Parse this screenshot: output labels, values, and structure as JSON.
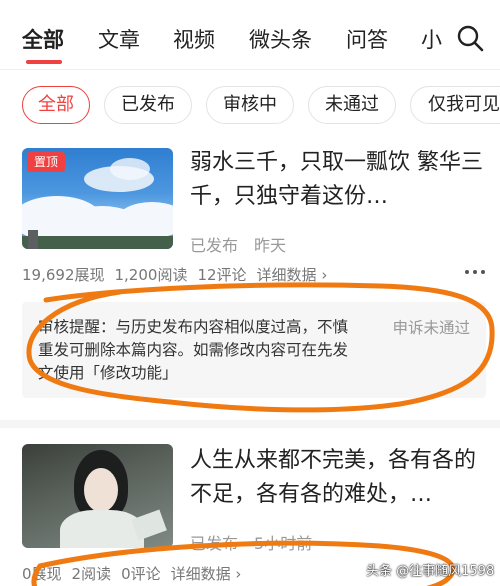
{
  "top_tabs": [
    {
      "label": "全部"
    },
    {
      "label": "文章"
    },
    {
      "label": "视频"
    },
    {
      "label": "微头条"
    },
    {
      "label": "问答"
    },
    {
      "label": "小"
    }
  ],
  "filters": [
    {
      "label": "全部"
    },
    {
      "label": "已发布"
    },
    {
      "label": "审核中"
    },
    {
      "label": "未通过"
    },
    {
      "label": "仅我可见"
    }
  ],
  "articles": [
    {
      "badge": "置顶",
      "title": "弱水三千，只取一瓢饮 繁华三千，只独守着这份…",
      "status": "已发布",
      "time": "昨天",
      "views": "19,692展现",
      "reads": "1,200阅读",
      "comments": "12评论",
      "details": "详细数据 ›",
      "review_text": "审核提醒：与历史发布内容相似度过高，不慎重发可删除本篇内容。如需修改内容可在先发文使用「修改功能」",
      "appeal": "申诉未通过"
    },
    {
      "title": "人生从来都不完美，各有各的不足，各有各的难处，…",
      "status": "已发布",
      "time": "5小时前",
      "views": "0展现",
      "reads": "2阅读",
      "comments": "0评论",
      "details": "详细数据 ›"
    }
  ],
  "watermark": "头条 @往事随风1598",
  "colors": {
    "accent": "#f04142",
    "annotation": "#f07a12"
  }
}
